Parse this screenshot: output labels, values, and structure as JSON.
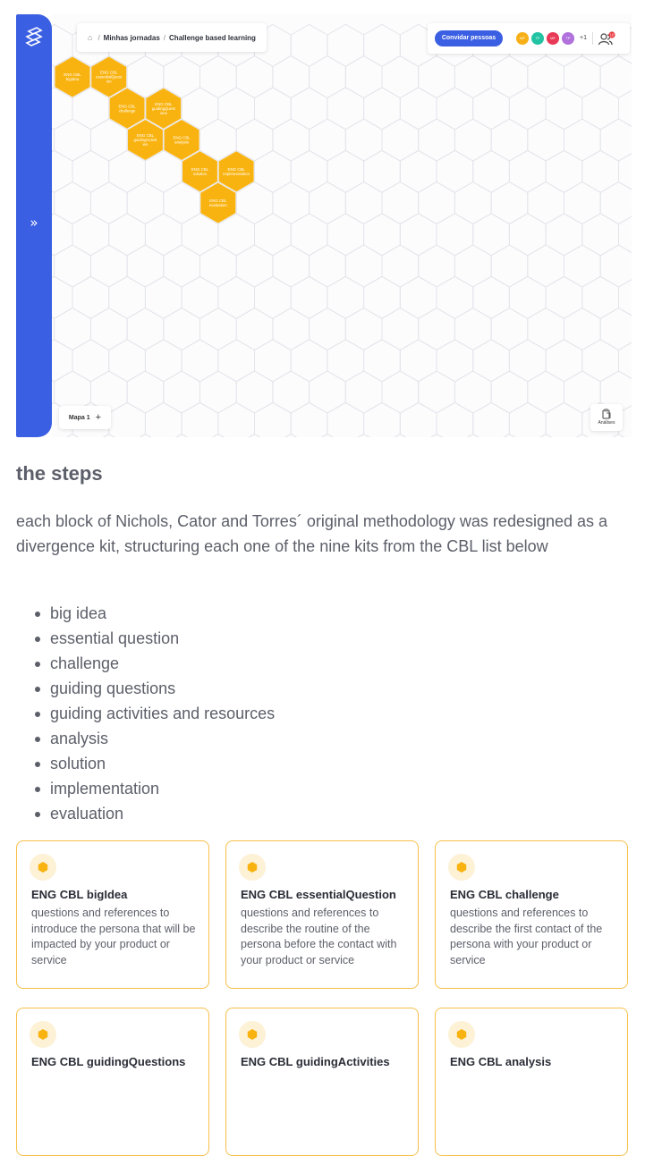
{
  "app": {
    "breadcrumb": {
      "home": "⌂",
      "sep": "/",
      "item1": "Minhas jornadas",
      "item2": "Challenge based learning"
    },
    "invite_button": "Convidar pessoas",
    "avatars": [
      {
        "initials": "MF",
        "color": "#f7b017"
      },
      {
        "initials": "TF",
        "color": "#22c3a3"
      },
      {
        "initials": "MF",
        "color": "#e83a57"
      },
      {
        "initials": "TP",
        "color": "#b071dc"
      }
    ],
    "more_count": "+1",
    "notification_count": "10",
    "expand_icon": "»",
    "map_tab": "Mapa 1",
    "map_add": "+",
    "analysis_label": "Análises",
    "hex_color": "#f9b310",
    "hexes": [
      {
        "lines": [
          "ENG CBL",
          "bigIdea"
        ]
      },
      {
        "lines": [
          "ENG CBL",
          "essentialQuest",
          "ion"
        ]
      },
      {
        "lines": [
          "ENG CBL",
          "challenge"
        ]
      },
      {
        "lines": [
          "ENG CBL",
          "guidingQuest",
          "ions"
        ]
      },
      {
        "lines": [
          "ENG CBL",
          "guidingActivit",
          "ies"
        ]
      },
      {
        "lines": [
          "ENG CBL",
          "analysis"
        ]
      },
      {
        "lines": [
          "ENG CBL",
          "solution"
        ]
      },
      {
        "lines": [
          "ENG CBL",
          "implementation"
        ]
      },
      {
        "lines": [
          "ENG CBL",
          "evaluation"
        ]
      }
    ]
  },
  "article": {
    "heading": "the steps",
    "intro": "each block of Nichols, Cator and Torres´ original methodology was redesigned as a divergence kit, structuring each one of the nine kits from the CBL list below",
    "list": [
      "big idea",
      "essential question",
      "challenge",
      "guiding questions",
      "guiding activities and resources",
      "analysis",
      "solution",
      "implementation",
      "evaluation"
    ],
    "cards": [
      {
        "title": "ENG CBL bigIdea",
        "desc": "questions and references to introduce the persona that will be impacted by your product or service"
      },
      {
        "title": "ENG CBL essentialQuestion",
        "desc": "questions and references to describe the routine of the persona before the contact with your product or service"
      },
      {
        "title": "ENG CBL challenge",
        "desc": "questions and references to describe the first contact of the persona with your product or service"
      },
      {
        "title": "ENG CBL guidingQuestions",
        "desc": ""
      },
      {
        "title": "ENG CBL guidingActivities",
        "desc": ""
      },
      {
        "title": "ENG CBL analysis",
        "desc": ""
      }
    ],
    "accent_color": "#f6bf4a"
  }
}
